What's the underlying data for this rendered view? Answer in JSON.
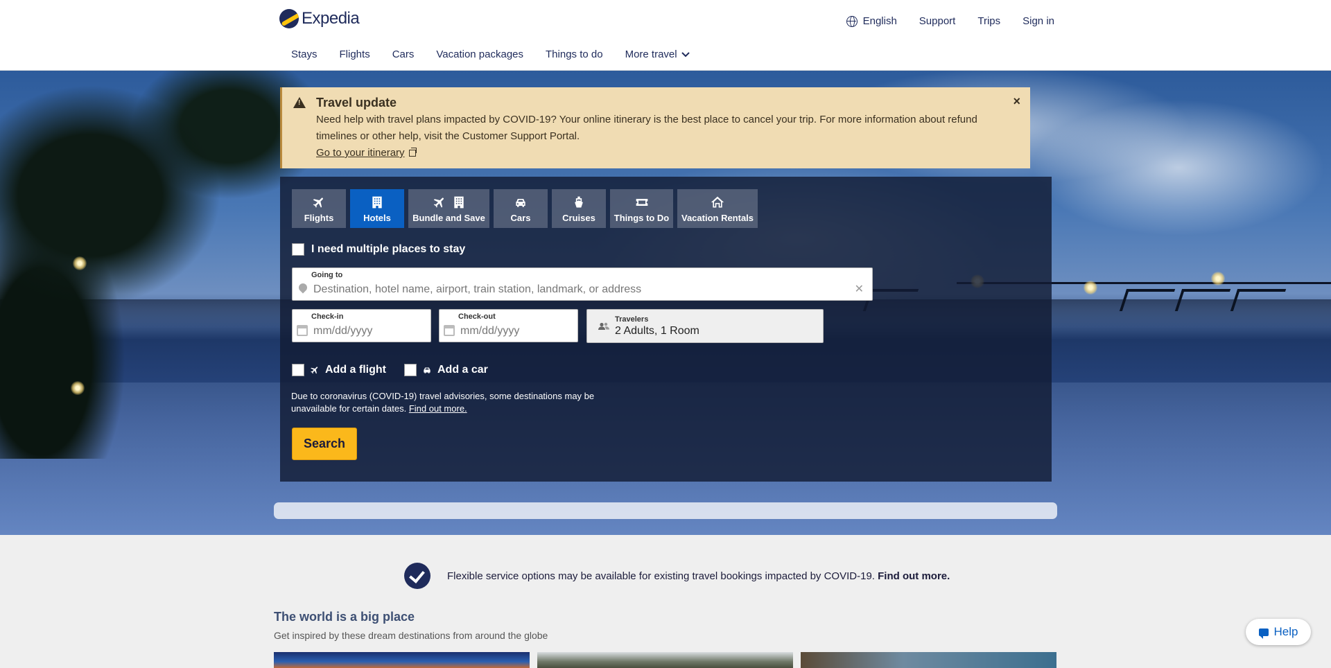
{
  "header": {
    "logo_text": "Expedia",
    "top_links": [
      "English",
      "Support",
      "Trips",
      "Sign in"
    ],
    "nav": [
      "Stays",
      "Flights",
      "Cars",
      "Vacation packages",
      "Things to do",
      "More travel"
    ]
  },
  "alert": {
    "title": "Travel update",
    "body": "Need help with travel plans impacted by COVID-19? Your online itinerary is the best place to cancel your trip. For more information about refund timelines or other help, visit the Customer Support Portal.",
    "link": "Go to your itinerary",
    "close": "×"
  },
  "search": {
    "tabs": [
      "Flights",
      "Hotels",
      "Bundle and Save",
      "Cars",
      "Cruises",
      "Things to Do",
      "Vacation Rentals"
    ],
    "active_tab": "Hotels",
    "multi_places": "I need multiple places to stay",
    "going_to": {
      "label": "Going to",
      "placeholder": "Destination, hotel name, airport, train station, landmark, or address"
    },
    "check_in": {
      "label": "Check-in",
      "placeholder": "mm/dd/yyyy"
    },
    "check_out": {
      "label": "Check-out",
      "placeholder": "mm/dd/yyyy"
    },
    "travelers": {
      "label": "Travelers",
      "value": "2 Adults, 1 Room"
    },
    "add_flight": "Add a flight",
    "add_car": "Add a car",
    "advisory": "Due to coronavirus (COVID-19) travel advisories, some destinations may be unavailable for certain dates.",
    "advisory_link": "Find out more.",
    "search_button": "Search"
  },
  "notice": {
    "text": "Flexible service options may be available for existing travel bookings impacted by COVID-19.",
    "link": "Find out more."
  },
  "inspire": {
    "title": "The world is a big place",
    "subtitle": "Get inspired by these dream destinations from around the globe"
  },
  "help_button": "Help",
  "colors": {
    "brand_blue": "#1f2b5b",
    "active_tab": "#0a60c2",
    "search_yellow": "#fbb81b",
    "alert_bg": "#f0dcb3"
  }
}
